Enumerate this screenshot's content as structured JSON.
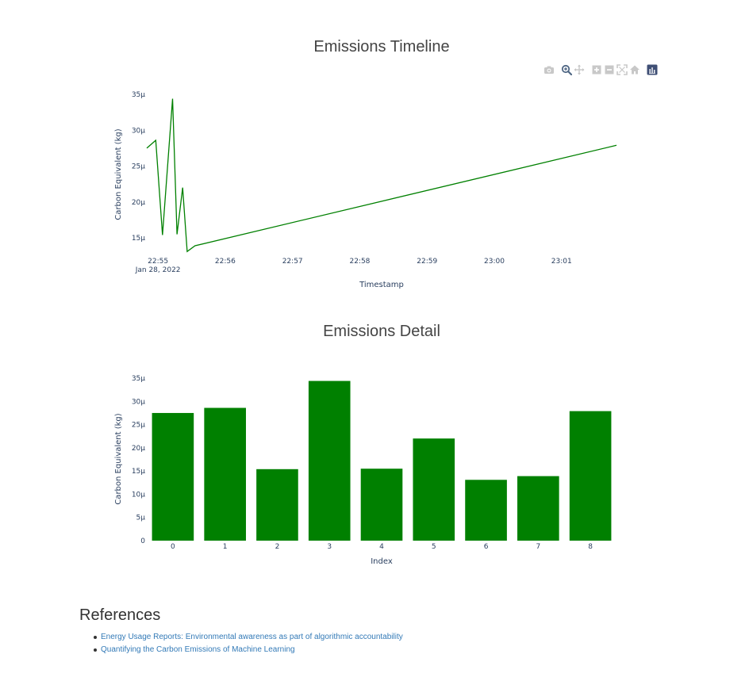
{
  "colors": {
    "series": "#008000",
    "modebar_icon": "#c8c8c8",
    "modebar_active": "#506784"
  },
  "modebar": {
    "buttons": [
      {
        "name": "camera-icon",
        "active": false
      },
      {
        "name": "zoom-icon",
        "active": true
      },
      {
        "name": "pan-icon",
        "active": false
      },
      {
        "name": "zoom-in-icon",
        "active": false
      },
      {
        "name": "zoom-out-icon",
        "active": false
      },
      {
        "name": "autoscale-icon",
        "active": false
      },
      {
        "name": "home-icon",
        "active": false
      },
      {
        "name": "plotly-logo-icon",
        "active": false
      }
    ]
  },
  "chart_data": [
    {
      "type": "line",
      "title": "Emissions Timeline",
      "xlabel": "Timestamp",
      "ylabel": "Carbon Equivalent (kg)",
      "x": [
        "22:54:50",
        "22:54:58",
        "22:55:04",
        "22:55:13",
        "22:55:17",
        "22:55:22",
        "22:55:26",
        "22:55:33",
        "23:01:49"
      ],
      "y": [
        27.5,
        28.6,
        15.4,
        34.4,
        15.5,
        22.0,
        13.1,
        13.9,
        27.9
      ],
      "xticks": [
        "22:55",
        "22:56",
        "22:57",
        "22:58",
        "22:59",
        "23:00",
        "23:01"
      ],
      "xtick_subtitle": "Jan 28, 2022",
      "yticks": [
        "15μ",
        "20μ",
        "25μ",
        "30μ",
        "35μ"
      ],
      "ylim": [
        12.8,
        36
      ],
      "unit_scale": "μ",
      "grid": false
    },
    {
      "type": "bar",
      "title": "Emissions Detail",
      "xlabel": "Index",
      "ylabel": "Carbon Equivalent (kg)",
      "categories": [
        "0",
        "1",
        "2",
        "3",
        "4",
        "5",
        "6",
        "7",
        "8"
      ],
      "values": [
        27.5,
        28.6,
        15.4,
        34.4,
        15.5,
        22.0,
        13.1,
        13.9,
        27.9
      ],
      "yticks": [
        "0",
        "5μ",
        "10μ",
        "15μ",
        "20μ",
        "25μ",
        "30μ",
        "35μ"
      ],
      "ylim": [
        0,
        36.2
      ],
      "unit_scale": "μ",
      "grid": false
    }
  ],
  "references": {
    "heading": "References",
    "items": [
      "Energy Usage Reports: Environmental awareness as part of algorithmic accountability",
      "Quantifying the Carbon Emissions of Machine Learning"
    ]
  }
}
